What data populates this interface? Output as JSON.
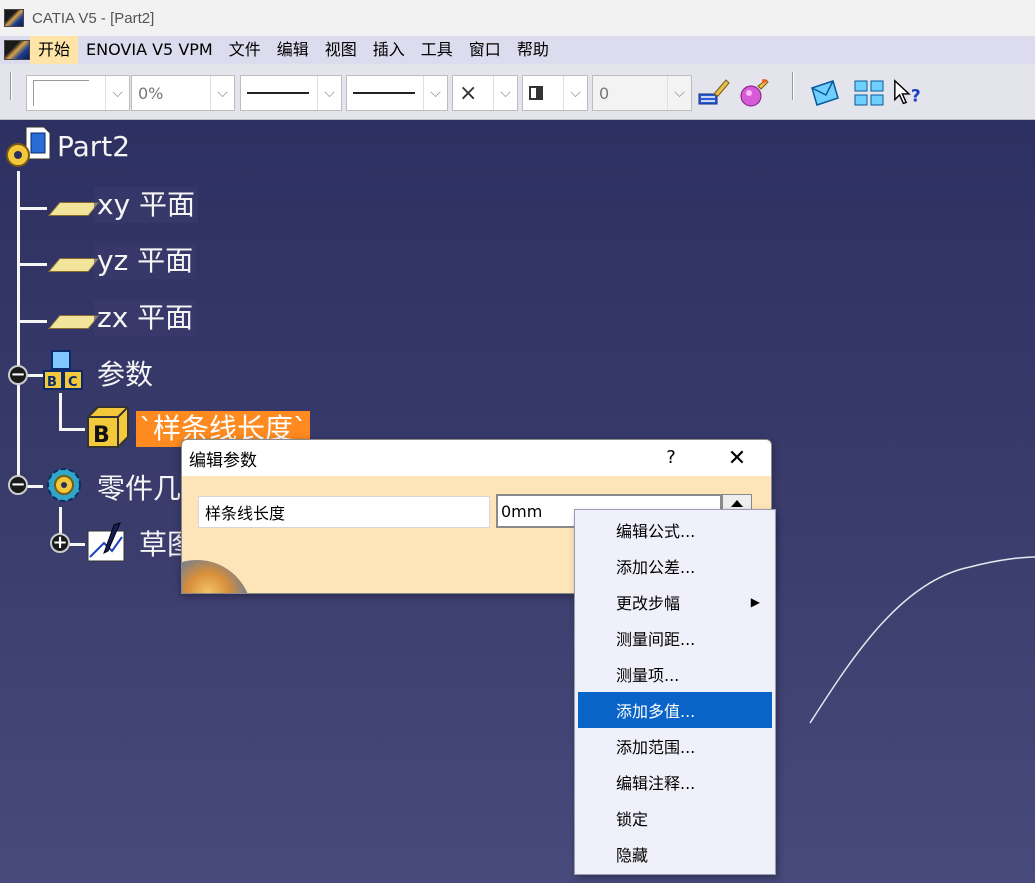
{
  "window": {
    "title": "CATIA V5 - [Part2]"
  },
  "menubar": {
    "items": [
      "开始",
      "ENOVIA V5 VPM",
      "文件",
      "编辑",
      "视图",
      "插入",
      "工具",
      "窗口",
      "帮助"
    ]
  },
  "toolbar": {
    "color_combo": "",
    "transparency_combo": "0%",
    "line_thickness_combo": "",
    "line_type_combo": "",
    "point_symbol_combo": "×",
    "layer_combo": "",
    "rendering_value": "0",
    "icons": [
      "painter-brush-icon",
      "apply-material-icon",
      "envelope-icon",
      "multi-view-icon",
      "whats-this-icon"
    ]
  },
  "tree": {
    "root": "Part2",
    "planes": [
      "xy 平面",
      "yz 平面",
      "zx 平面"
    ],
    "parameters_node": "参数",
    "parameter_item": "`样条线长度`",
    "geometry_node": "零件几",
    "sketch_node": "草图"
  },
  "dialog": {
    "title": "编辑参数",
    "help": "?",
    "close": "✕",
    "param_name": "样条线长度",
    "param_value": "0mm"
  },
  "context_menu": {
    "items": [
      {
        "label": "编辑公式...",
        "highlight": false,
        "submenu": false
      },
      {
        "label": "添加公差...",
        "highlight": false,
        "submenu": false
      },
      {
        "label": "更改步幅",
        "highlight": false,
        "submenu": true
      },
      {
        "label": "测量间距...",
        "highlight": false,
        "submenu": false
      },
      {
        "label": "测量项...",
        "highlight": false,
        "submenu": false
      },
      {
        "label": "添加多值...",
        "highlight": true,
        "submenu": false
      },
      {
        "label": "添加范围...",
        "highlight": false,
        "submenu": false
      },
      {
        "label": "编辑注释...",
        "highlight": false,
        "submenu": false
      },
      {
        "label": "锁定",
        "highlight": false,
        "submenu": false
      },
      {
        "label": "隐藏",
        "highlight": false,
        "submenu": false
      }
    ]
  },
  "colors": {
    "viewer_bg": "#383a6a",
    "selection": "#ff8a1f",
    "menu_highlight": "#0a64c8",
    "dialog_bg": "#fde4b9"
  }
}
